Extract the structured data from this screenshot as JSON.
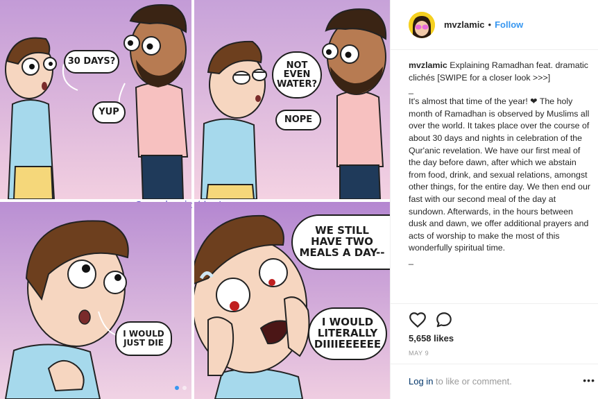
{
  "comic": {
    "bubbles": {
      "thirty_days": "30 DAYS?",
      "yup": "YUP",
      "not_even_water": "NOT\nEVEN\nWATER?",
      "nope": "NOPE",
      "would_die": "I WOULD\nJUST DIE",
      "two_meals": "WE STILL\nHAVE TWO\nMEALS A DAY--",
      "literally": "I WOULD\nLITERALLY\nDIIIIEEEEEE"
    },
    "watermark": "@mvzlamic / Instagram"
  },
  "header": {
    "username": "mvzlamic",
    "separator": "•",
    "follow_label": "Follow"
  },
  "caption": {
    "username": "mvzlamic",
    "title": "Explaining Ramadhan feat. dramatic clichés [SWIPE for a closer look >>>]",
    "separator": "_",
    "body": "It's almost that time of the year! ❤ The holy month of Ramadhan is observed by Muslims all over the world. It takes place over the course of about 30 days and nights in celebration of the Qur'anic revelation. We have our first meal of the day before dawn, after which we abstain from food, drink, and sexual relations, amongst other things, for the entire day. We then end our fast with our second meal of the day at sundown. Afterwards, in the hours between dusk and dawn, we offer additional prayers and acts of worship to make the most of this wonderfully spiritual time.",
    "separator_end": "_"
  },
  "actions": {
    "like_icon": "heart-icon",
    "comment_icon": "comment-icon"
  },
  "likes": "5,658 likes",
  "date": "MAY 9",
  "login": {
    "link": "Log in",
    "rest": " to like or comment."
  },
  "more": "•••",
  "colors": {
    "link_blue": "#3897f0",
    "login_blue": "#003569",
    "watermark": "#5b54c8",
    "avatar_bg": "#f5d020"
  }
}
